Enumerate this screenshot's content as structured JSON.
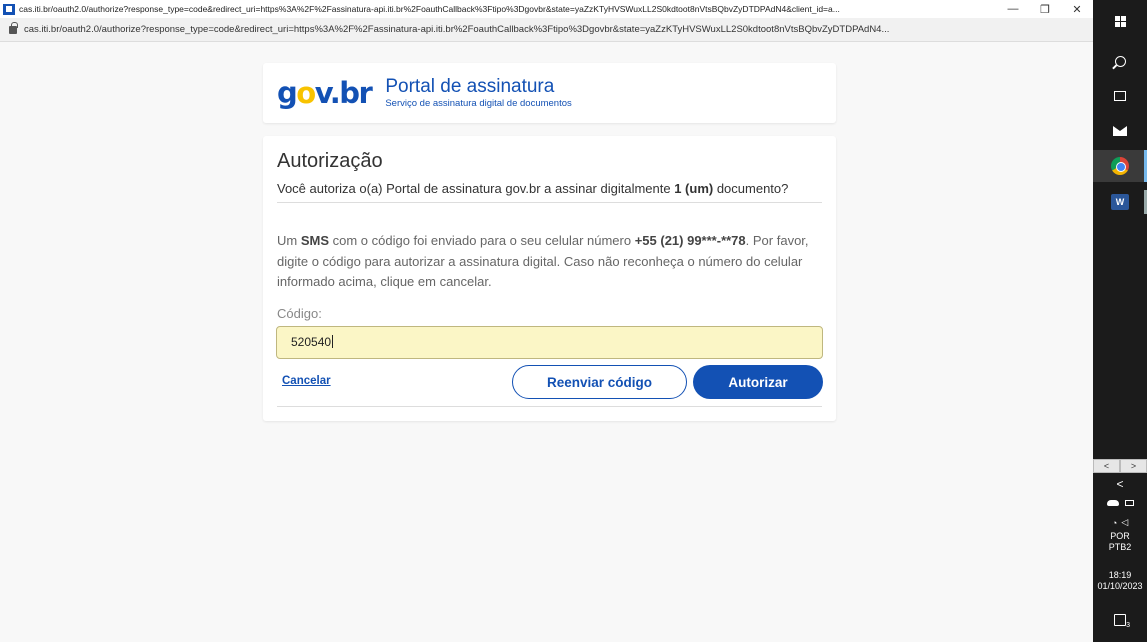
{
  "browser": {
    "window_title": "cas.iti.br/oauth2.0/authorize?response_type=code&redirect_uri=https%3A%2F%2Fassinatura-api.iti.br%2FoauthCallback%3Ftipo%3Dgovbr&state=yaZzKTyHVSWuxLL2S0kdtoot8nVtsBQbvZyDTDPAdN4&client_id=a...",
    "url": "cas.iti.br/oauth2.0/authorize?response_type=code&redirect_uri=https%3A%2F%2Fassinatura-api.iti.br%2FoauthCallback%3Ftipo%3Dgovbr&state=yaZzKTyHVSWuxLL2S0kdtoot8nVtsBQbvZyDTDPAdN4...",
    "minimize": "—",
    "maximize": "❐",
    "close": "✕"
  },
  "header": {
    "logo_g": "g",
    "logo_o": "o",
    "logo_v": "v",
    "logo_dot": ".",
    "logo_br": "br",
    "title": "Portal de assinatura",
    "subtitle": "Serviço de assinatura digital de documentos"
  },
  "auth": {
    "title": "Autorização",
    "question_prefix": "Você autoriza o(a) Portal de assinatura gov.br a assinar digitalmente ",
    "question_bold": "1 (um)",
    "question_suffix": " documento?",
    "sms_prefix": "Um ",
    "sms_bold": "SMS",
    "sms_mid": " com o código foi enviado para o seu celular número ",
    "sms_phone": "+55 (21) 99***-**78",
    "sms_suffix": ". Por favor, digite o código para autorizar a assinatura digital. Caso não reconheça o número do celular informado acima, clique em cancelar.",
    "code_label": "Código:",
    "code_value": "520540",
    "cancel_label": "Cancelar",
    "resend_label": "Reenviar código",
    "authorize_label": "Autorizar"
  },
  "taskbar": {
    "word_label": "W",
    "scroll_left": "<",
    "scroll_right": ">",
    "expand": "<",
    "language": "POR",
    "layout": "PTB2",
    "time": "18:19",
    "date": "01/10/2023",
    "notifications": "3"
  },
  "colors": {
    "brand_blue": "#1351b4",
    "brand_yellow": "#f8c300",
    "input_bg": "#fbf6c6"
  }
}
